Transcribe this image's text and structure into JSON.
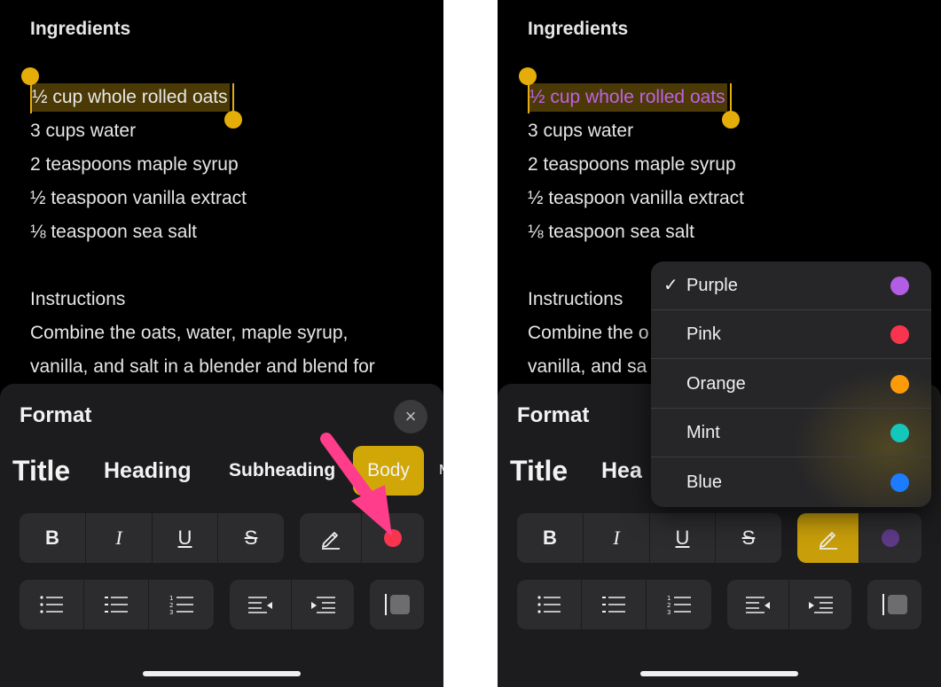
{
  "note": {
    "heading": "Ingredients",
    "selected_line": "½ cup whole rolled oats",
    "lines": [
      "3 cups water",
      "2 teaspoons maple syrup",
      "½ teaspoon vanilla extract",
      "⅛ teaspoon sea salt"
    ],
    "instructions_heading": "Instructions",
    "instructions_lines": [
      "Combine the oats, water, maple syrup,",
      "vanilla, and salt in a blender and blend for"
    ],
    "instructions_lines_right": [
      "Combine the o",
      "vanilla, and sa"
    ]
  },
  "format_sheet": {
    "title": "Format",
    "close_icon": "×",
    "styles": [
      "Title",
      "Heading",
      "Subheading",
      "Body",
      "M"
    ],
    "styles_right": [
      "Title",
      "Hea"
    ],
    "selected_style": "Body",
    "text_buttons": [
      "B",
      "I",
      "U",
      "S"
    ],
    "highlight_icon": "pencil-icon",
    "highlight_color_left": "#f9344f",
    "highlight_color_right": "#5e3a87"
  },
  "color_menu": {
    "items": [
      {
        "label": "Purple",
        "color": "#b15ee4",
        "checked": true,
        "check": "✓"
      },
      {
        "label": "Pink",
        "color": "#f9344f",
        "checked": false
      },
      {
        "label": "Orange",
        "color": "#fd9a0a",
        "checked": false
      },
      {
        "label": "Mint",
        "color": "#14c7ba",
        "checked": false
      },
      {
        "label": "Blue",
        "color": "#1b7cff",
        "checked": false
      }
    ]
  },
  "colors": {
    "accent_yellow": "#d0a707",
    "arrow_pink": "#ff3d8b",
    "panel_bg": "#000000",
    "sheet_bg": "#1c1c1e"
  }
}
